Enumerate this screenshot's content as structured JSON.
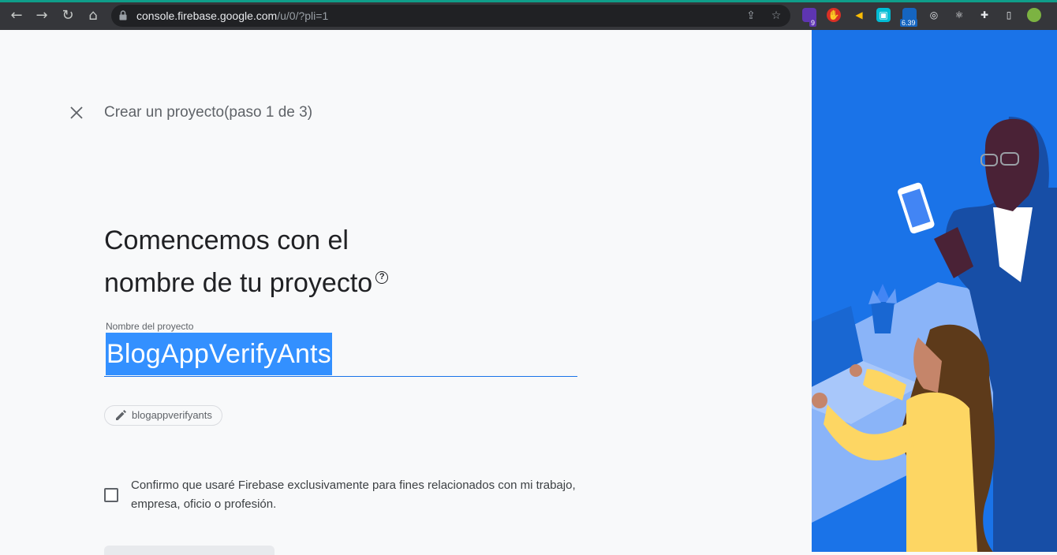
{
  "browser": {
    "url_host": "console.firebase.google.com",
    "url_path": "/u/0/?pli=1",
    "extensions": [
      {
        "name": "extension-badge-icon",
        "badge": "9"
      },
      {
        "name": "extension-badge-icon-2",
        "badge": "6.39"
      }
    ]
  },
  "page": {
    "step_title": "Crear un proyecto(paso 1 de 3)",
    "heading_line1": "Comencemos con el",
    "heading_line2": "nombre de tu proyecto",
    "field_label": "Nombre del proyecto",
    "field_value": "BlogAppVerifyAnts",
    "project_id_chip": "blogappverifyants",
    "confirm_text": "Confirmo que usaré Firebase exclusivamente para fines relacionados con mi trabajo, empresa, oficio o profesión.",
    "confirm_checked": false
  },
  "colors": {
    "accent": "#1a73e8",
    "selection": "#3390ff"
  }
}
